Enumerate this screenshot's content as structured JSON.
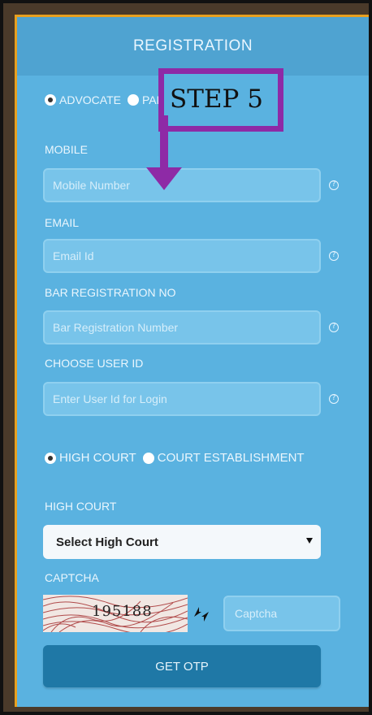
{
  "header": {
    "title": "REGISTRATION"
  },
  "user_type": {
    "options": [
      "ADVOCATE",
      "PARTY IN PERSON"
    ],
    "selected": "ADVOCATE"
  },
  "annotation": {
    "step_label": "STEP 5",
    "color": "#8e2aa6"
  },
  "fields": {
    "mobile": {
      "label": "MOBILE",
      "placeholder": "Mobile Number"
    },
    "email": {
      "label": "EMAIL",
      "placeholder": "Email Id"
    },
    "bar_reg": {
      "label": "BAR REGISTRATION NO",
      "placeholder": "Bar Registration Number"
    },
    "user_id": {
      "label": "CHOOSE USER ID",
      "placeholder": "Enter User Id for Login"
    }
  },
  "court_type": {
    "options": [
      "HIGH COURT",
      "COURT ESTABLISHMENT"
    ],
    "selected": "HIGH COURT"
  },
  "high_court": {
    "label": "HIGH COURT",
    "selected": "Select High Court"
  },
  "captcha": {
    "label": "CAPTCHA",
    "image_text": "195188",
    "placeholder": "Captcha"
  },
  "actions": {
    "get_otp": "GET OTP"
  },
  "icons": {
    "help": "question-circle-icon",
    "refresh": "refresh-icon",
    "dropdown": "caret-down-icon"
  },
  "colors": {
    "panel": "#5ab2e0",
    "button": "#1f78a6"
  }
}
